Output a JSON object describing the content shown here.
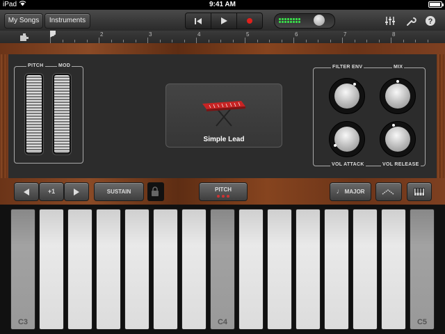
{
  "status_bar": {
    "device": "iPad",
    "time": "9:41 AM"
  },
  "toolbar": {
    "my_songs_label": "My Songs",
    "instruments_label": "Instruments",
    "rewind_glyph": "⏮",
    "play_glyph": "▶",
    "record_color": "#e0201c"
  },
  "ruler": {
    "bars": [
      "1",
      "2",
      "3",
      "4",
      "5",
      "6",
      "7",
      "8"
    ]
  },
  "panel": {
    "pitch_label": "PITCH",
    "mod_label": "MOD",
    "instrument_name": "Simple Lead",
    "filter_env_label": "FILTER ENV",
    "mix_label": "MIX",
    "vol_attack_label": "VOL ATTACK",
    "vol_release_label": "VOL RELEASE"
  },
  "controls": {
    "octave_value": "+1",
    "sustain_label": "SUSTAIN",
    "pitch_label": "PITCH",
    "major_label": "MAJOR"
  },
  "keys": [
    {
      "label": "C3",
      "dim": true
    },
    {
      "label": "",
      "dim": false
    },
    {
      "label": "",
      "dim": false
    },
    {
      "label": "",
      "dim": false
    },
    {
      "label": "",
      "dim": false
    },
    {
      "label": "",
      "dim": false
    },
    {
      "label": "",
      "dim": false
    },
    {
      "label": "C4",
      "dim": true
    },
    {
      "label": "",
      "dim": false
    },
    {
      "label": "",
      "dim": false
    },
    {
      "label": "",
      "dim": false
    },
    {
      "label": "",
      "dim": false
    },
    {
      "label": "",
      "dim": false
    },
    {
      "label": "",
      "dim": false
    },
    {
      "label": "C5",
      "dim": true
    }
  ],
  "colors": {
    "accent_green": "#39e04a",
    "wood": "#7a3d1d"
  }
}
